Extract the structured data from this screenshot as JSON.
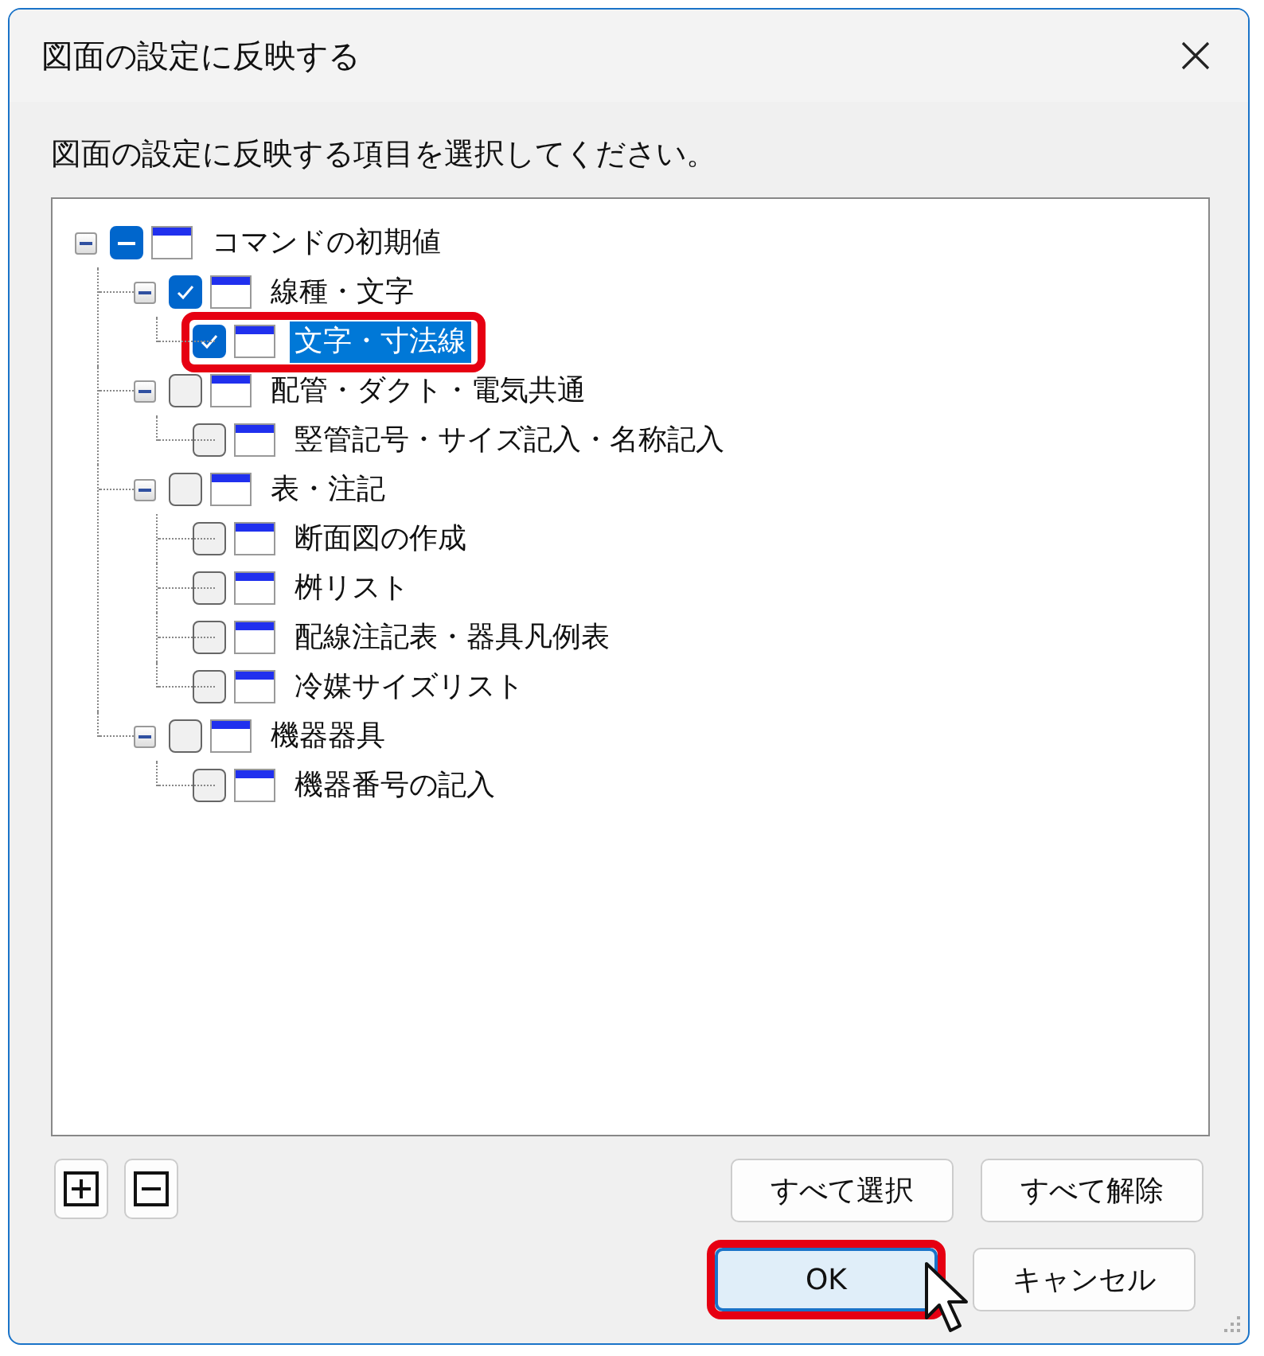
{
  "window": {
    "title": "図面の設定に反映する"
  },
  "instruction": "図面の設定に反映する項目を選択してください。",
  "tree": [
    {
      "label": "コマンドの初期値",
      "checked": false,
      "indeterminate": true,
      "expanded": true,
      "selected": false,
      "highlighted": false,
      "children": [
        {
          "label": "線種・文字",
          "checked": true,
          "indeterminate": false,
          "expanded": true,
          "selected": false,
          "highlighted": false,
          "children": [
            {
              "label": "文字・寸法線",
              "checked": true,
              "indeterminate": false,
              "selected": true,
              "highlighted": true
            }
          ]
        },
        {
          "label": "配管・ダクト・電気共通",
          "checked": false,
          "indeterminate": false,
          "expanded": true,
          "selected": false,
          "highlighted": false,
          "children": [
            {
              "label": "竪管記号・サイズ記入・名称記入",
              "checked": false,
              "indeterminate": false,
              "selected": false,
              "highlighted": false
            }
          ]
        },
        {
          "label": "表・注記",
          "checked": false,
          "indeterminate": false,
          "expanded": true,
          "selected": false,
          "highlighted": false,
          "children": [
            {
              "label": "断面図の作成",
              "checked": false,
              "indeterminate": false,
              "selected": false,
              "highlighted": false
            },
            {
              "label": "桝リスト",
              "checked": false,
              "indeterminate": false,
              "selected": false,
              "highlighted": false
            },
            {
              "label": "配線注記表・器具凡例表",
              "checked": false,
              "indeterminate": false,
              "selected": false,
              "highlighted": false
            },
            {
              "label": "冷媒サイズリスト",
              "checked": false,
              "indeterminate": false,
              "selected": false,
              "highlighted": false
            }
          ]
        },
        {
          "label": "機器器具",
          "checked": false,
          "indeterminate": false,
          "expanded": true,
          "selected": false,
          "highlighted": false,
          "children": [
            {
              "label": "機器番号の記入",
              "checked": false,
              "indeterminate": false,
              "selected": false,
              "highlighted": false
            }
          ]
        }
      ]
    }
  ],
  "selection_buttons": [
    {
      "label": "すべて選択"
    },
    {
      "label": "すべて解除"
    }
  ],
  "dialog_buttons": [
    {
      "label": "OK",
      "default": true,
      "highlighted": true
    },
    {
      "label": "キャンセル",
      "default": false,
      "highlighted": false
    }
  ]
}
